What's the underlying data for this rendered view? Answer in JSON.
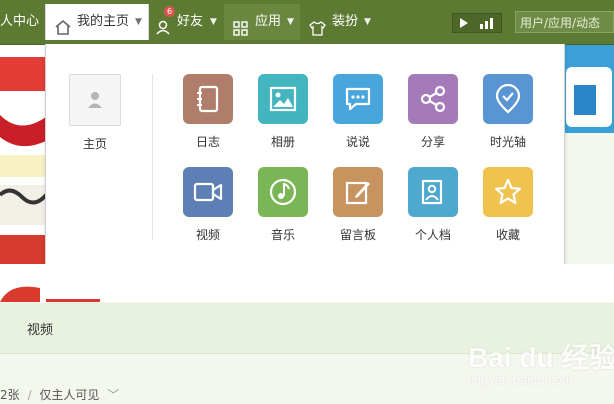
{
  "nav": {
    "personal_center": "人中心",
    "my_home": "我的主页",
    "friends": "好友",
    "friends_badge": "6",
    "apps": "应用",
    "dress_up": "装扮",
    "search_placeholder": "用户/应用/动态"
  },
  "dropdown": {
    "home_label": "主页",
    "apps": [
      {
        "label": "日志",
        "color": "#b07d6a",
        "icon": "notebook-icon"
      },
      {
        "label": "相册",
        "color": "#43b5be",
        "icon": "photo-icon"
      },
      {
        "label": "说说",
        "color": "#49a6dd",
        "icon": "chat-bubble-icon"
      },
      {
        "label": "分享",
        "color": "#a57ab8",
        "icon": "share-icon"
      },
      {
        "label": "时光轴",
        "color": "#5a95d3",
        "icon": "timeline-icon"
      },
      {
        "label": "视频",
        "color": "#5d7fb5",
        "icon": "video-icon"
      },
      {
        "label": "音乐",
        "color": "#7ab656",
        "icon": "music-icon"
      },
      {
        "label": "留言板",
        "color": "#c7935f",
        "icon": "message-board-icon"
      },
      {
        "label": "个人档",
        "color": "#4fa9cf",
        "icon": "profile-icon"
      },
      {
        "label": "收藏",
        "color": "#f0c24f",
        "icon": "star-icon"
      }
    ]
  },
  "page": {
    "tab_video": "视频",
    "photo_count": "2张",
    "visibility": "仅主人可见"
  },
  "watermark": {
    "text": "Bai du 经验",
    "sub": "jingyan.baidu.com"
  }
}
